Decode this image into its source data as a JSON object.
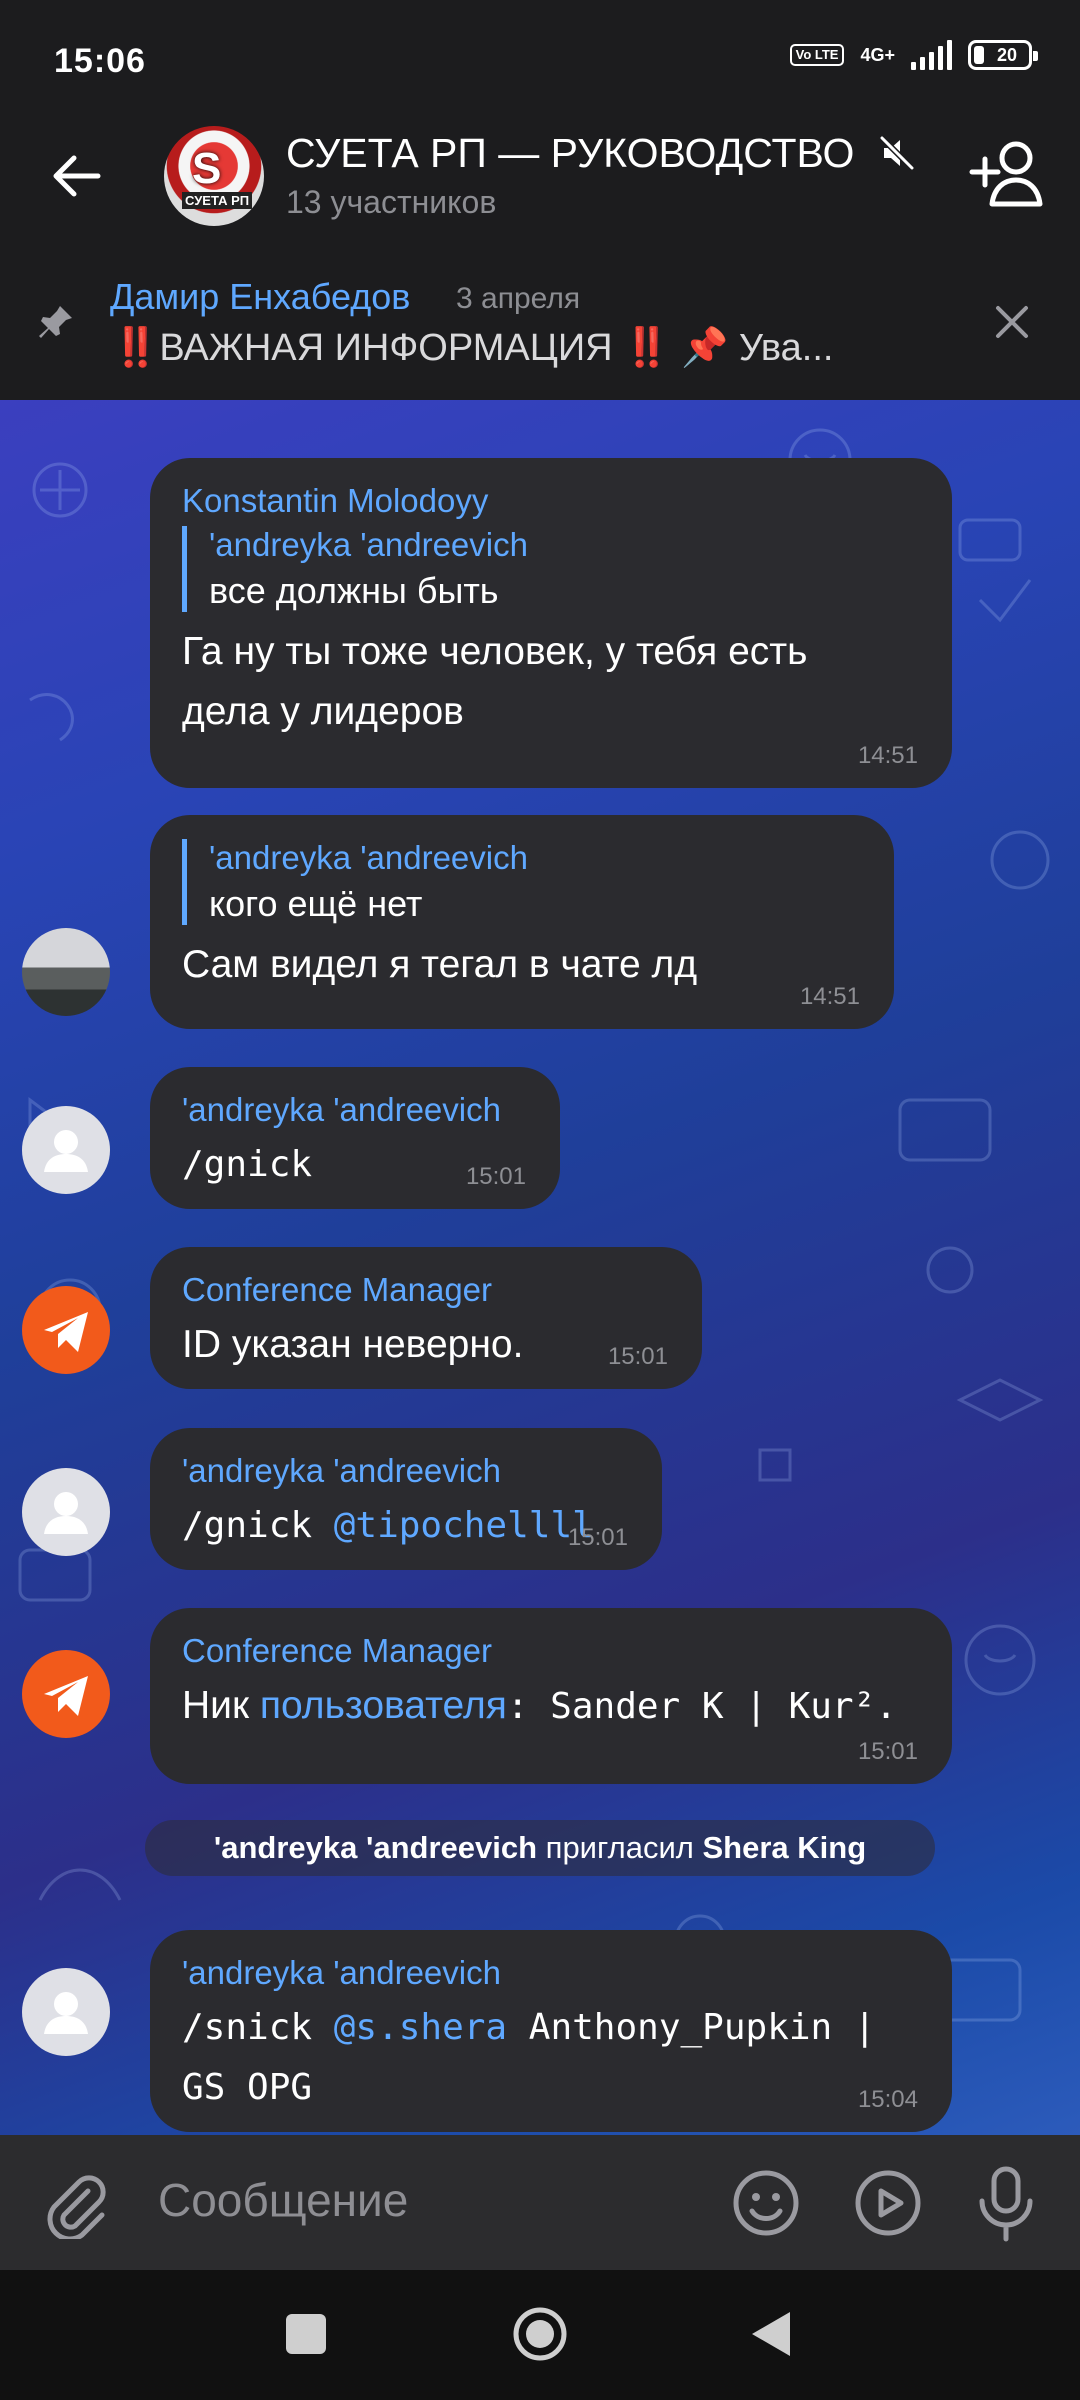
{
  "status_bar": {
    "time": "15:06",
    "volte": "Vo LTE",
    "network": "4G+",
    "battery": "20"
  },
  "header": {
    "title": "СУЕТА РП — РУКОВОДСТВО",
    "subtitle": "13 участников",
    "avatar_logo": "S",
    "avatar_caption": "СУЕТА РП"
  },
  "pinned": {
    "author": "Дамир Енхабедов",
    "date": "3 апреля",
    "text": "‼️ВАЖНАЯ ИНФОРМАЦИЯ ‼️   📌 Ува..."
  },
  "messages": [
    {
      "author": "Konstantin Molodoyy",
      "reply_author": "'andreyka 'andreevich",
      "reply_text": "все должны быть",
      "text": "Га ну ты тоже человек, у тебя есть дела у лидеров",
      "time": "14:51"
    },
    {
      "reply_author": "'andreyka 'andreevich",
      "reply_text": "кого ещё нет",
      "text": "Сам видел я тегал в чате лд",
      "time": "14:51"
    },
    {
      "author": "'andreyka 'andreevich",
      "text": "/gnick",
      "time": "15:01"
    },
    {
      "author": "Conference Manager",
      "text": "ID указан неверно.",
      "time": "15:01"
    },
    {
      "author": "'andreyka 'andreevich",
      "text_cmd": "/gnick ",
      "text_link": "@tipochellll",
      "time": "15:01"
    },
    {
      "author": "Conference Manager",
      "text_pre": "Ник ",
      "text_link": "пользователя",
      "text_post": ": Sander K | Kur².",
      "time": "15:01"
    },
    {
      "author": "'andreyka 'andreevich",
      "text_cmd": "/snick ",
      "text_link": "@s.shera",
      "text_post": " Anthony_Pupkin | GS OPG",
      "time": "15:04"
    }
  ],
  "service_message": {
    "actor": "'andreyka 'andreevich",
    "action": " пригласил ",
    "target": "Shera King"
  },
  "input": {
    "placeholder": "Сообщение"
  },
  "colors": {
    "accent": "#5fa8ff",
    "bubble": "#2b2b2f",
    "bot_avatar": "#f25a1b"
  }
}
